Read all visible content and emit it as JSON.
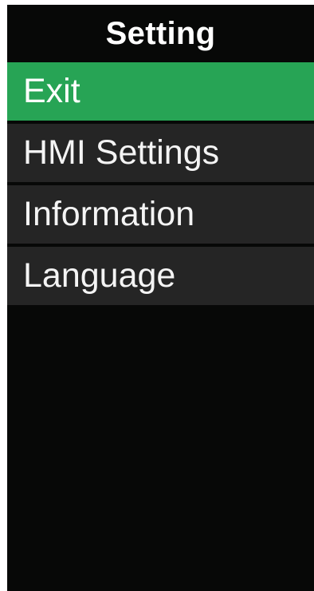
{
  "header": {
    "title": "Setting"
  },
  "menu": {
    "items": [
      {
        "label": "Exit",
        "selected": true
      },
      {
        "label": "HMI Settings",
        "selected": false
      },
      {
        "label": "Information",
        "selected": false
      },
      {
        "label": "Language",
        "selected": false
      }
    ]
  },
  "colors": {
    "screen_background": "#070807",
    "item_background": "#252525",
    "selected_background": "#27a455",
    "text": "#f4f4f4"
  }
}
